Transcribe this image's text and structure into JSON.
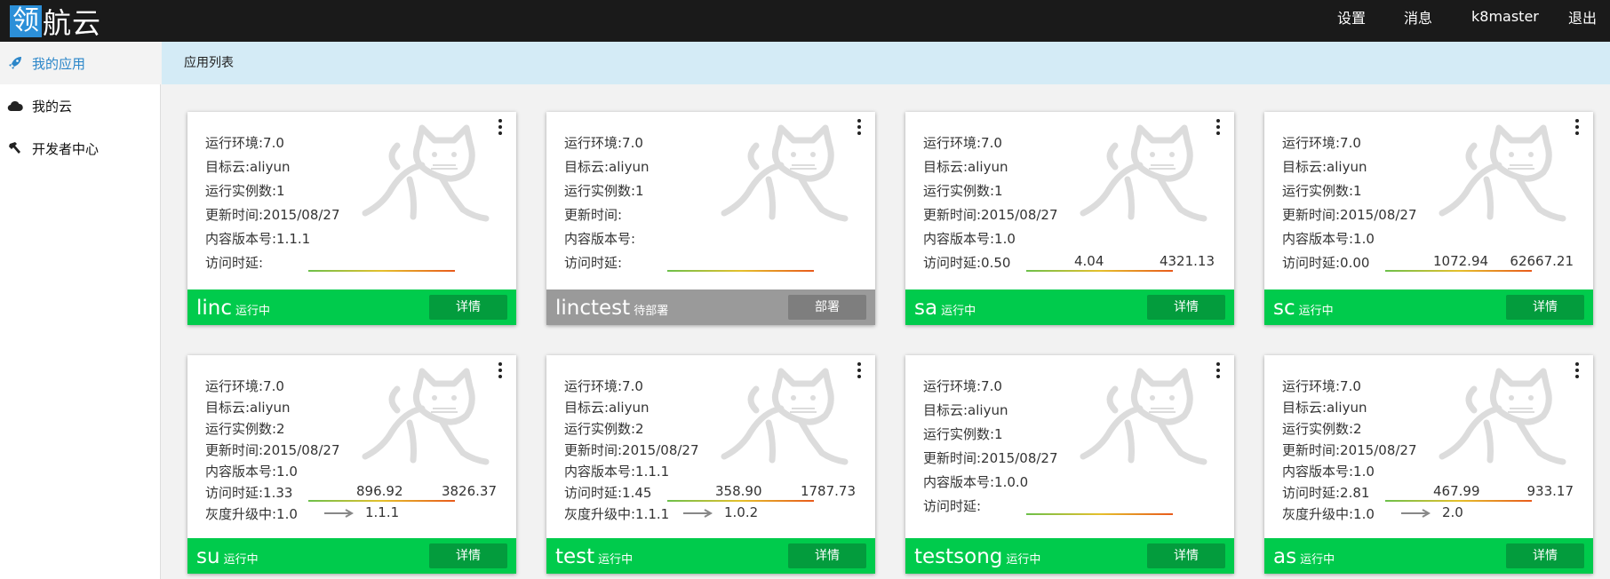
{
  "topbar": {
    "logo_box": "领",
    "logo_rest": "航云",
    "nav": [
      "设置",
      "消息",
      "k8master",
      "退出"
    ]
  },
  "sidebar": {
    "items": [
      {
        "label": "我的应用",
        "icon": "rocket-icon",
        "active": true
      },
      {
        "label": "我的云",
        "icon": "cloud-icon",
        "active": false
      },
      {
        "label": "开发者中心",
        "icon": "hammer-icon",
        "active": false
      }
    ]
  },
  "header": {
    "title": "应用列表"
  },
  "colors": {
    "running": "#00cb4c",
    "pending": "#9a9a9a",
    "accent": "#2b86c9",
    "topbar": "#1a1a1a"
  },
  "apps": [
    {
      "name": "linc",
      "status": "运行中",
      "button": "详情",
      "lines": [
        "运行环境:7.0",
        "目标云:aliyun",
        "运行实例数:1",
        "更新时间:2015/08/27",
        "内容版本号:1.1.1",
        "访问时延:"
      ],
      "latency_mid": "",
      "latency_max": ""
    },
    {
      "name": "linctest",
      "status": "待部署",
      "button": "部署",
      "lines": [
        "运行环境:7.0",
        "目标云:aliyun",
        "运行实例数:1",
        "更新时间:",
        "内容版本号:",
        "访问时延:"
      ],
      "latency_mid": "",
      "latency_max": ""
    },
    {
      "name": "sa",
      "status": "运行中",
      "button": "详情",
      "lines": [
        "运行环境:7.0",
        "目标云:aliyun",
        "运行实例数:1",
        "更新时间:2015/08/27",
        "内容版本号:1.0",
        "访问时延:0.50"
      ],
      "latency_mid": "4.04",
      "latency_max": "4321.13"
    },
    {
      "name": "sc",
      "status": "运行中",
      "button": "详情",
      "lines": [
        "运行环境:7.0",
        "目标云:aliyun",
        "运行实例数:1",
        "更新时间:2015/08/27",
        "内容版本号:1.0",
        "访问时延:0.00"
      ],
      "latency_mid": "1072.94",
      "latency_max": "62667.21"
    },
    {
      "name": "su",
      "status": "运行中",
      "button": "详情",
      "lines": [
        "运行环境:7.0",
        "目标云:aliyun",
        "运行实例数:2",
        "更新时间:2015/08/27",
        "内容版本号:1.0",
        "访问时延:1.33",
        "灰度升级中:1.0"
      ],
      "latency_mid": "896.92",
      "latency_max": "3826.37",
      "upgrade_to": "1.1.1"
    },
    {
      "name": "test",
      "status": "运行中",
      "button": "详情",
      "lines": [
        "运行环境:7.0",
        "目标云:aliyun",
        "运行实例数:2",
        "更新时间:2015/08/27",
        "内容版本号:1.1.1",
        "访问时延:1.45",
        "灰度升级中:1.1.1"
      ],
      "latency_mid": "358.90",
      "latency_max": "1787.73",
      "upgrade_to": "1.0.2"
    },
    {
      "name": "testsong",
      "status": "运行中",
      "button": "详情",
      "lines": [
        "运行环境:7.0",
        "目标云:aliyun",
        "运行实例数:1",
        "更新时间:2015/08/27",
        "内容版本号:1.0.0",
        "访问时延:"
      ],
      "latency_mid": "",
      "latency_max": ""
    },
    {
      "name": "as",
      "status": "运行中",
      "button": "详情",
      "lines": [
        "运行环境:7.0",
        "目标云:aliyun",
        "运行实例数:2",
        "更新时间:2015/08/27",
        "内容版本号:1.0",
        "访问时延:2.81",
        "灰度升级中:1.0"
      ],
      "latency_mid": "467.99",
      "latency_max": "933.17",
      "upgrade_to": "2.0"
    }
  ]
}
